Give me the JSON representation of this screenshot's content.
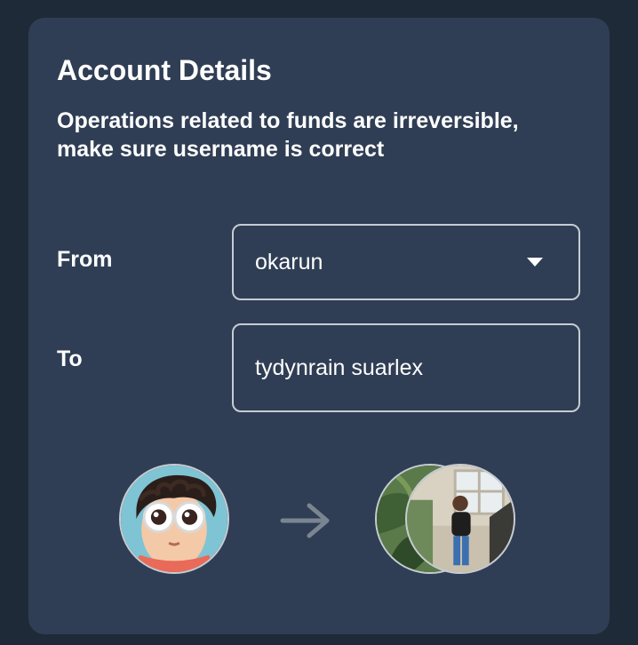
{
  "card": {
    "title": "Account Details",
    "subtitle": "Operations related to funds are irreversible, make sure username is correct"
  },
  "form": {
    "from_label": "From",
    "from_value": "okarun",
    "to_label": "To",
    "to_value": "tydynrain suarlex"
  },
  "icons": {
    "dropdown": "caret-down-icon",
    "transfer_arrow": "arrow-right-icon"
  },
  "colors": {
    "background": "#1f2a38",
    "card": "#2f3e54",
    "text": "#ffffff",
    "border": "#c7ccd3",
    "arrow": "#7b8592"
  }
}
